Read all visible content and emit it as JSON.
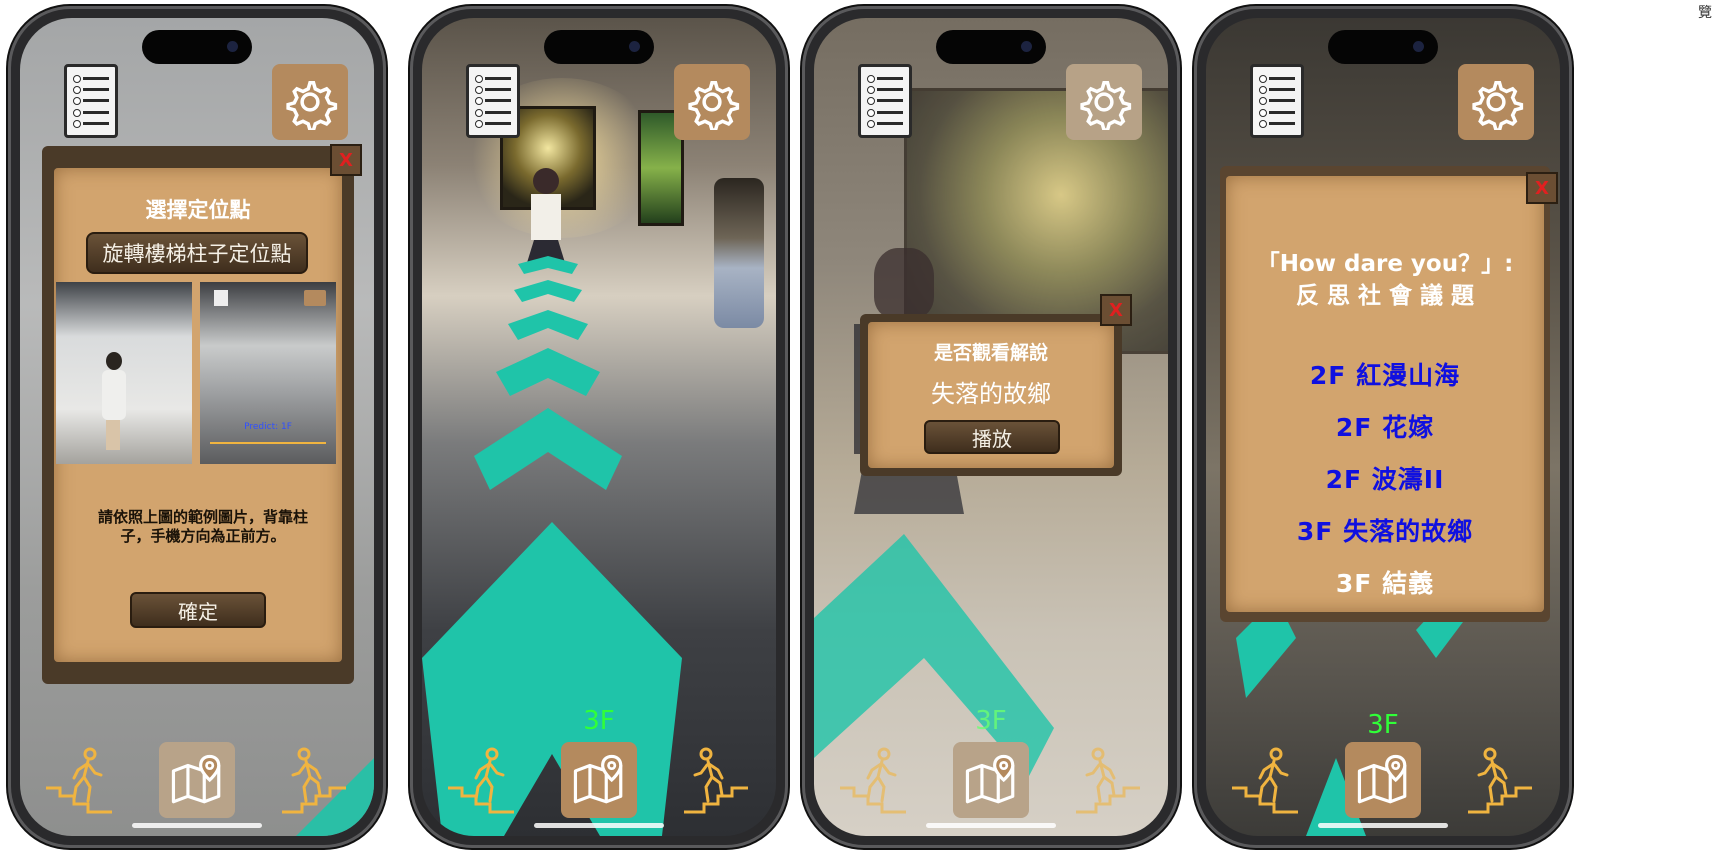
{
  "colors": {
    "accent_brown": "#b48a5e",
    "arrow_teal": "#1fc4a9",
    "floor_green": "#30ff38",
    "menu_blue": "#1010e0"
  },
  "screens": [
    {
      "dialog": {
        "title": "選擇定位點",
        "location_value": "旋轉樓梯柱子定位點",
        "example_predict_text": "Predict: 1F",
        "instruction": "請依照上圖的範例圖片，背靠柱子，手機方向為正前方。",
        "confirm_label": "確定",
        "close_label": "X"
      }
    },
    {
      "floor_label": "3F"
    },
    {
      "floor_label": "3F",
      "dialog": {
        "prompt": "是否觀看解說",
        "artwork_title": "失落的故鄉",
        "play_label": "播放",
        "close_label": "X"
      }
    },
    {
      "floor_label": "3F",
      "dialog": {
        "title_line1": "「How dare you？」:",
        "title_line2": "反 思 社 會 議 題",
        "items": [
          "2F 紅漫山海",
          "2F 花嫁",
          "2F 波濤II",
          "3F 失落的故鄉",
          "3F 結義"
        ],
        "close_label": "X"
      }
    }
  ],
  "icons": {
    "list": "list-scroll-icon",
    "settings": "gear-icon",
    "map": "map-pin-icon",
    "stairs_down": "stairs-down-icon",
    "stairs_up": "stairs-up-icon"
  },
  "edge_text": "覽"
}
